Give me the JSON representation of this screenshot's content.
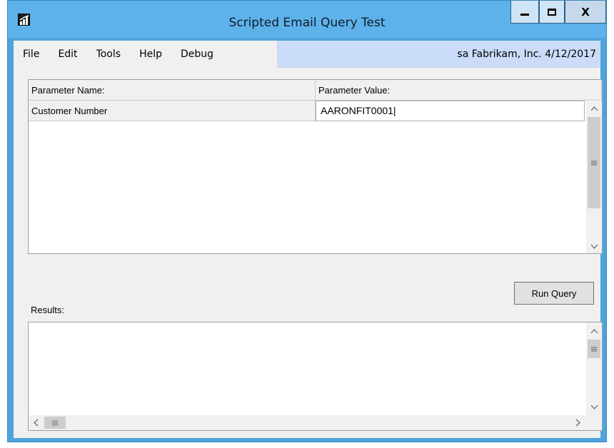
{
  "window": {
    "title": "Scripted Email Query Test",
    "close_glyph": "X"
  },
  "menu": {
    "items": [
      "File",
      "Edit",
      "Tools",
      "Help",
      "Debug"
    ],
    "status": "sa  Fabrikam, Inc.  4/12/2017"
  },
  "grid": {
    "header_name": "Parameter Name:",
    "header_value": "Parameter Value:",
    "rows": [
      {
        "name": "Customer Number",
        "value": "AARONFIT0001|"
      }
    ]
  },
  "actions": {
    "run_query": "Run Query"
  },
  "results": {
    "label": "Results:"
  },
  "colors": {
    "titlebar": "#5eb2ea",
    "frame": "#4fa3dc",
    "menu_status_bg": "#cbdcf8",
    "client_bg": "#f0f0f0"
  }
}
